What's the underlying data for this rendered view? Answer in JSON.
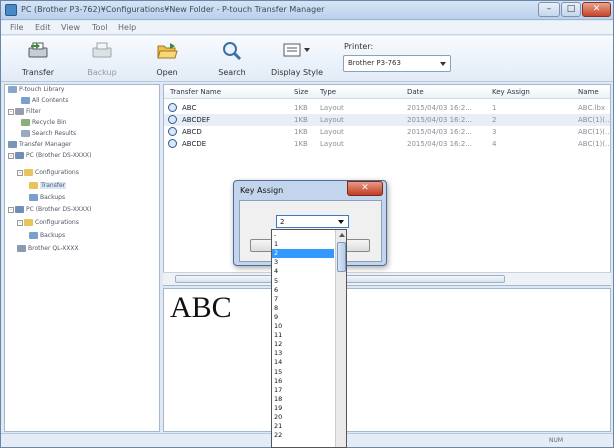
{
  "window": {
    "title": "PC (Brother P3-762)¥Configurations¥New Folder - P-touch Transfer Manager",
    "minimize": "–",
    "maximize": "□",
    "close": "✕"
  },
  "menu": [
    "File",
    "Edit",
    "View",
    "Tool",
    "Help"
  ],
  "toolbar": {
    "transfer": "Transfer",
    "backup": "Backup",
    "open": "Open",
    "search": "Search",
    "display_style": "Display Style",
    "printer_label": "Printer:",
    "printer_value": "Brother P3-763"
  },
  "tree": [
    {
      "label": "P-touch Library",
      "icon": "library-icon",
      "color": "#8aa6c8"
    },
    {
      "label": "All Contents",
      "icon": "contents-icon",
      "color": "#7a9fce"
    },
    {
      "label": "Filter",
      "icon": "filter-icon",
      "color": "#9a9ab5"
    },
    {
      "label": "Recycle Bin",
      "icon": "recycle-bin-icon",
      "color": "#8ab07a"
    },
    {
      "label": "Search Results",
      "icon": "search-results-icon",
      "color": "#9aa9bd"
    },
    {
      "label": "Transfer Manager",
      "icon": "transfer-manager-icon",
      "color": "#7a96bb"
    },
    {
      "label": "PC (Brother DS-XXXX)",
      "icon": "computer-icon",
      "color": "#6f8fb8"
    },
    {
      "label": "Configurations",
      "icon": "folder-icon",
      "color": "#e8c45a"
    },
    {
      "label": "Transfer",
      "icon": "folder-open-icon",
      "color": "#e8c45a"
    },
    {
      "label": "Backups",
      "icon": "backups-icon",
      "color": "#7a9fce"
    },
    {
      "label": "PC (Brother DS-XXXX)",
      "icon": "computer-icon",
      "color": "#6f8fb8"
    },
    {
      "label": "Configurations",
      "icon": "folder-icon",
      "color": "#e8c45a"
    },
    {
      "label": "Backups",
      "icon": "backups-icon",
      "color": "#7a9fce"
    },
    {
      "label": "Brother QL-XXXX",
      "icon": "printer-icon",
      "color": "#8a9ab0"
    }
  ],
  "list": {
    "columns": [
      "Transfer Name",
      "Size",
      "Type",
      "Date",
      "Key Assign",
      "Name"
    ],
    "rows": [
      {
        "name": "ABC",
        "size": "1KB",
        "type": "Layout",
        "date": "2015/04/03 16:2...",
        "key": "1",
        "file": "ABC.lbx"
      },
      {
        "name": "ABCDEF",
        "size": "1KB",
        "type": "Layout",
        "date": "2015/04/03 16:2...",
        "key": "2",
        "file": "ABC(1)(..."
      },
      {
        "name": "ABCD",
        "size": "1KB",
        "type": "Layout",
        "date": "2015/04/03 16:2...",
        "key": "3",
        "file": "ABC(1)(..."
      },
      {
        "name": "ABCDE",
        "size": "1KB",
        "type": "Layout",
        "date": "2015/04/03 16:2...",
        "key": "4",
        "file": "ABC(1)(..."
      }
    ]
  },
  "preview": {
    "text": "ABC"
  },
  "status": {
    "num": "NUM"
  },
  "dialog": {
    "title": "Key Assign",
    "close": "✕",
    "selected": "2",
    "options": [
      "-",
      "1",
      "2",
      "3",
      "4",
      "5",
      "6",
      "7",
      "8",
      "9",
      "10",
      "11",
      "12",
      "13",
      "14",
      "15",
      "16",
      "17",
      "18",
      "19",
      "20",
      "21",
      "22"
    ]
  }
}
